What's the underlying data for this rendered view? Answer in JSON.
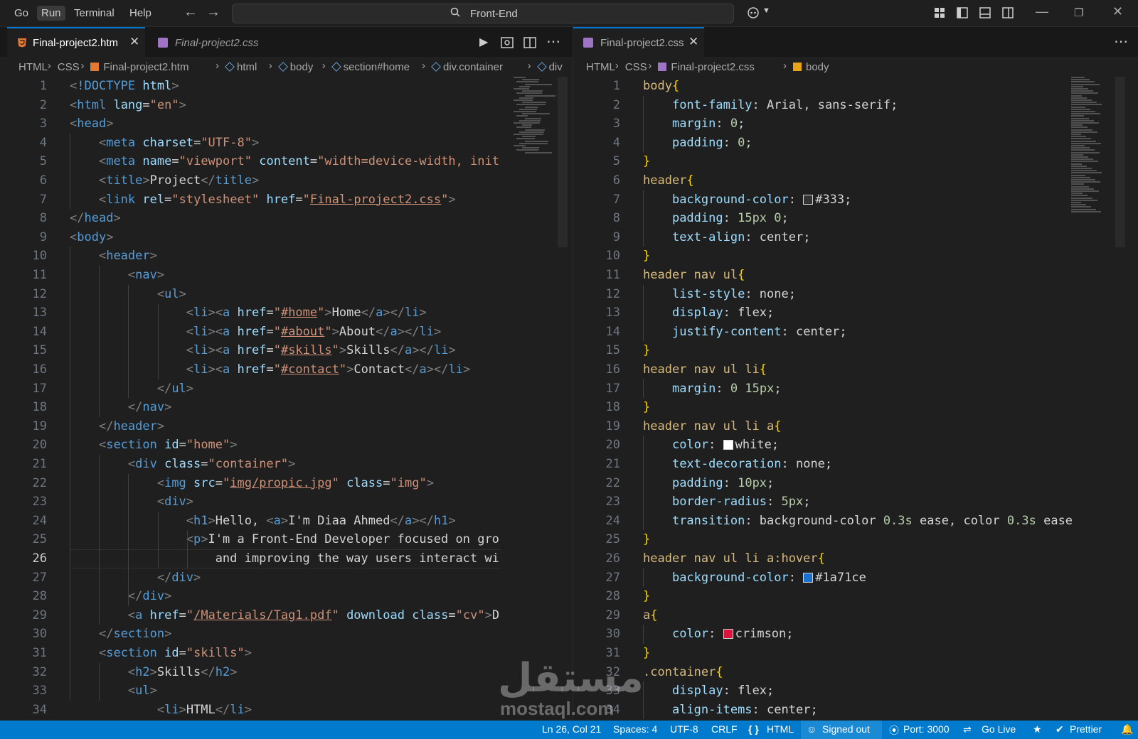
{
  "menu": [
    "Go",
    "Run",
    "Terminal",
    "Help"
  ],
  "search": {
    "text": "Front-End"
  },
  "colors": {
    "accent": "#0078d4",
    "status_bar": "#007acc",
    "html_icon": "#e37933",
    "css_icon": "#a074c4"
  },
  "left": {
    "tabs": [
      {
        "label": "Final-project2.htm",
        "active": true,
        "icon": "html-file-icon"
      },
      {
        "label": "Final-project2.css",
        "active": false,
        "icon": "css-file-icon"
      }
    ],
    "breadcrumbs": [
      "HTML",
      "CSS",
      "Final-project2.htm",
      "html",
      "body",
      "section#home",
      "div.container",
      "div"
    ]
  },
  "right": {
    "tabs": [
      {
        "label": "Final-project2.css",
        "active": true,
        "icon": "css-file-icon"
      }
    ],
    "breadcrumbs": [
      "HTML",
      "CSS",
      "Final-project2.css",
      "body"
    ]
  },
  "html_lines": [
    "<!DOCTYPE html>",
    "<html lang=\"en\">",
    "<head>",
    "    <meta charset=\"UTF-8\">",
    "    <meta name=\"viewport\" content=\"width=device-width, init",
    "    <title>Project</title>",
    "    <link rel=\"stylesheet\" href=\"Final-project2.css\">",
    "</head>",
    "<body>",
    "    <header>",
    "        <nav>",
    "            <ul>",
    "                <li><a href=\"#home\">Home</a></li>",
    "                <li><a href=\"#about\">About</a></li>",
    "                <li><a href=\"#skills\">Skills</a></li>",
    "                <li><a href=\"#contact\">Contact</a></li>",
    "            </ul>",
    "        </nav>",
    "    </header>",
    "    <section id=\"home\">",
    "        <div class=\"container\">",
    "            <img src=\"img/propic.jpg\" class=\"img\">",
    "            <div>",
    "                <h1>Hello, <a>I'm Diaa Ahmed</a></h1>",
    "                <p>I'm a Front-End Developer focused on gro",
    "                    and improving the way users interact wi",
    "            </div>",
    "        </div>",
    "        <a href=\"/Materials/Tag1.pdf\" download class=\"cv\">D",
    "    </section>",
    "    <section id=\"skills\">",
    "        <h2>Skills</h2>",
    "        <ul>",
    "            <li>HTML</li>"
  ],
  "css_lines": [
    "body{",
    "    font-family: Arial, sans-serif;",
    "    margin: 0;",
    "    padding: 0;",
    "}",
    "header{",
    "    background-color: #333;",
    "    padding: 15px 0;",
    "    text-align: center;",
    "}",
    "header nav ul{",
    "    list-style: none;",
    "    display: flex;",
    "    justify-content: center;",
    "}",
    "header nav ul li{",
    "    margin: 0 15px;",
    "}",
    "header nav ul li a{",
    "    color: white;",
    "    text-decoration: none;",
    "    padding: 10px;",
    "    border-radius: 5px;",
    "    transition: background-color 0.3s ease, color 0.3s ease",
    "}",
    "header nav ul li a:hover{",
    "    background-color: #1a71ce",
    "}",
    "a{",
    "    color: crimson;",
    "}",
    ".container{",
    "    display: flex;",
    "    align-items: center;"
  ],
  "current_line": 26,
  "status": {
    "position": "Ln 26, Col 21",
    "spaces": "Spaces: 4",
    "encoding": "UTF-8",
    "eol": "CRLF",
    "language": "HTML",
    "account": "Signed out",
    "port": "Port: 3000",
    "golive": "Go Live",
    "prettier": "Prettier"
  },
  "watermark": {
    "arabic": "مستقل",
    "latin": "mostaql.com"
  }
}
